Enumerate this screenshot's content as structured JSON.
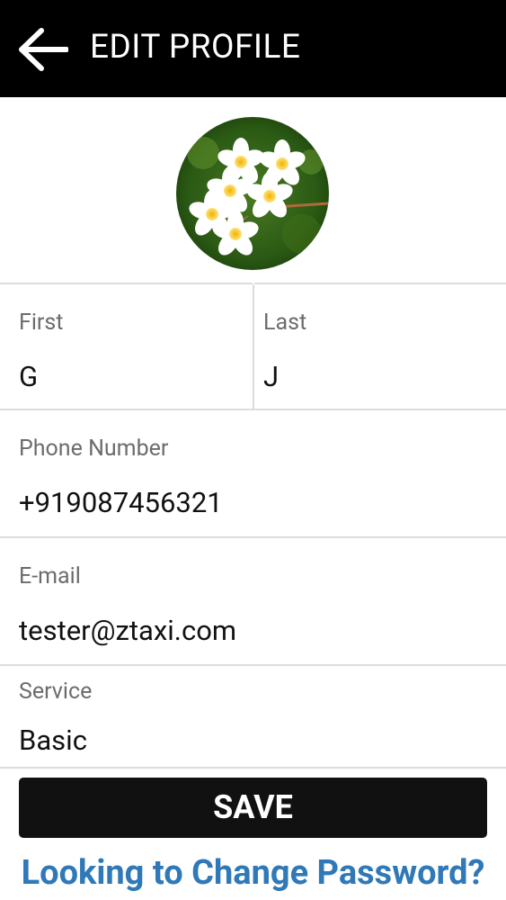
{
  "header": {
    "title": "EDIT PROFILE",
    "back_icon": "arrow-left-icon"
  },
  "avatar": {
    "alt": "Profile picture"
  },
  "form": {
    "first": {
      "label": "First",
      "value": "G"
    },
    "last": {
      "label": "Last",
      "value": "J"
    },
    "phone": {
      "label": "Phone Number",
      "value": "+919087456321"
    },
    "email": {
      "label": "E-mail",
      "value": "tester@ztaxi.com"
    },
    "service": {
      "label": "Service",
      "value": "Basic"
    }
  },
  "actions": {
    "save_label": "SAVE",
    "change_password_label": "Looking to Change Password?"
  },
  "colors": {
    "header_bg": "#000000",
    "button_bg": "#111111",
    "link": "#2f79b8",
    "divider": "#dcdcdc"
  }
}
